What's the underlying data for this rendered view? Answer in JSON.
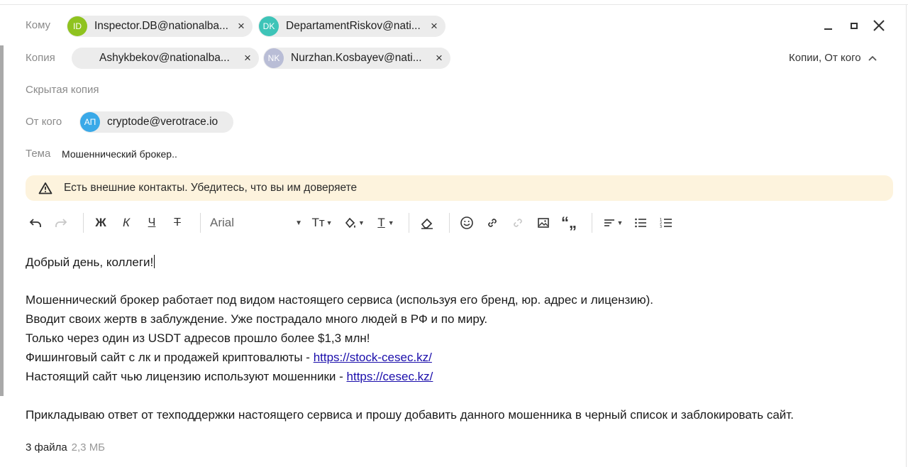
{
  "header": {
    "to_label": "Кому",
    "cc_label": "Копия",
    "bcc_label": "Скрытая копия",
    "from_label": "От кого",
    "subject_label": "Тема",
    "subject_value": "Мошеннический брокер..",
    "cc_toggle": "Копии, От кого"
  },
  "to": [
    {
      "initials": "ID",
      "email": "Inspector.DB@nationalba...",
      "color": "#8fc31f"
    },
    {
      "initials": "DK",
      "email": "DepartamentRiskov@nati...",
      "color": "#3ec4b8"
    }
  ],
  "cc": [
    {
      "initials": "",
      "email": "Ashykbekov@nationalba...",
      "color": "#ececec"
    },
    {
      "initials": "NK",
      "email": "Nurzhan.Kosbayev@nati...",
      "color": "#b9bdd6"
    }
  ],
  "from": {
    "initials": "АП",
    "email": "cryptode@verotrace.io",
    "color": "#3aa9e8"
  },
  "warning": "Есть внешние контакты. Убедитесь, что вы им доверяете",
  "toolbar": {
    "bold": "Ж",
    "italic": "К",
    "underline": "Ч",
    "strike": "Т",
    "font": "Arial",
    "textsize": "Тт",
    "textcolor": "Т"
  },
  "message": {
    "greeting": "Добрый день, коллеги!",
    "line1": "Мошеннический брокер работает под видом настоящего сервиса (используя его бренд, юр. адрес и лицензию).",
    "line2": "Вводит своих жертв в заблуждение. Уже пострадало много людей в РФ и по миру.",
    "line3": "Только через один из USDT адресов прошло более $1,3 млн!",
    "line4_text": "Фишинговый сайт с лк и продажей криптовалюты - ",
    "line4_link": "https://stock-cesec.kz/",
    "line5_text": "Настоящий сайт чью лицензию используют мошенники - ",
    "line5_link": "https://cesec.kz/",
    "line6": "Прикладываю ответ от техподдержки настоящего сервиса и прошу добавить данного мошенника в черный список и заблокировать сайт."
  },
  "attachments": {
    "count": "3 файла",
    "size": "2,3 МБ"
  },
  "icons": {
    "undo": "undo-icon",
    "redo": "redo-icon",
    "warning": "warning-icon",
    "minimize": "minimize-icon",
    "restore": "restore-icon",
    "close": "close-icon"
  }
}
